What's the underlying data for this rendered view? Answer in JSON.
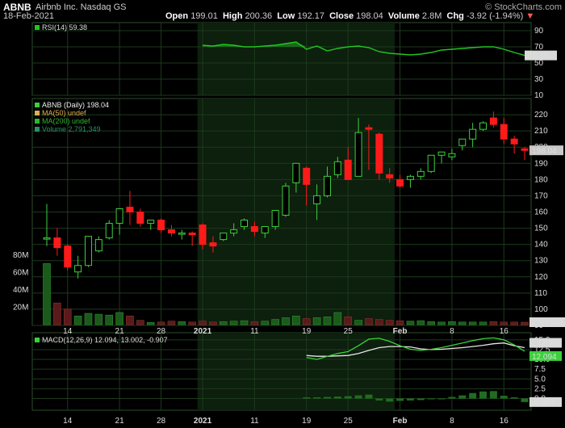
{
  "header": {
    "symbol": "ABNB",
    "company": "Airbnb Inc.  Nasdaq GS",
    "date": "18-Feb-2021",
    "open_label": "Open",
    "open": "199.01",
    "high_label": "High",
    "high": "200.36",
    "low_label": "Low",
    "low": "192.17",
    "close_label": "Close",
    "close": "198.04",
    "volume_label": "Volume",
    "volume": "2.8M",
    "chg_label": "Chg",
    "chg": "-3.92 (-1.94%)",
    "chg_icon": "down-triangle-icon",
    "brand": "© StockCharts.com"
  },
  "colors": {
    "up": "#3bd13b",
    "down": "#ff1a1a",
    "grid": "#1d3a1d",
    "rsi": "#22c422",
    "macd": "#3bd13b",
    "signal": "#e6e6e6",
    "price_badge": "#c8c8c8"
  },
  "chart_data": [
    {
      "type": "line",
      "name": "rsi-panel",
      "legend": "RSI(14) 59.38",
      "ylim": [
        10,
        100
      ],
      "yticks": [
        90,
        70,
        50,
        30,
        10
      ],
      "last_label": "59.38",
      "x": [
        "2021-01-04",
        "2021-01-05",
        "2021-01-06",
        "2021-01-07",
        "2021-01-08",
        "2021-01-11",
        "2021-01-12",
        "2021-01-13",
        "2021-01-14",
        "2021-01-15",
        "2021-01-19",
        "2021-01-20",
        "2021-01-21",
        "2021-01-22",
        "2021-01-25",
        "2021-01-26",
        "2021-01-27",
        "2021-01-28",
        "2021-01-29",
        "2021-02-01",
        "2021-02-02",
        "2021-02-03",
        "2021-02-04",
        "2021-02-05",
        "2021-02-08",
        "2021-02-09",
        "2021-02-10",
        "2021-02-11",
        "2021-02-12",
        "2021-02-16",
        "2021-02-17",
        "2021-02-18"
      ],
      "values": [
        72,
        71,
        73,
        72,
        70,
        70,
        71,
        72,
        74,
        76,
        67,
        71,
        65,
        68,
        70,
        71,
        69,
        64,
        62,
        61,
        60,
        61,
        63,
        66,
        67,
        68,
        69,
        70,
        70,
        67,
        63,
        59.38
      ]
    },
    {
      "type": "candlestick",
      "name": "price-panel",
      "legend": [
        "ABNB (Daily) 198.04",
        "MA(50) undef",
        "MA(200) undef",
        "Volume 2,791,349"
      ],
      "ylim": [
        90,
        230
      ],
      "yticks": [
        220,
        210,
        200,
        190,
        180,
        170,
        160,
        150,
        140,
        130,
        120,
        110,
        100,
        90
      ],
      "last_label": "198.04",
      "x_ticks": [
        "14",
        "21",
        "28",
        "2021",
        "11",
        "19",
        "25",
        "Feb",
        "8",
        "16"
      ],
      "x": [
        "2020-12-10",
        "2020-12-11",
        "2020-12-14",
        "2020-12-15",
        "2020-12-16",
        "2020-12-17",
        "2020-12-18",
        "2020-12-21",
        "2020-12-22",
        "2020-12-23",
        "2020-12-24",
        "2020-12-28",
        "2020-12-29",
        "2020-12-30",
        "2020-12-31",
        "2021-01-04",
        "2021-01-05",
        "2021-01-06",
        "2021-01-07",
        "2021-01-08",
        "2021-01-11",
        "2021-01-12",
        "2021-01-13",
        "2021-01-14",
        "2021-01-15",
        "2021-01-19",
        "2021-01-20",
        "2021-01-21",
        "2021-01-22",
        "2021-01-25",
        "2021-01-26",
        "2021-01-27",
        "2021-01-28",
        "2021-01-29",
        "2021-02-01",
        "2021-02-02",
        "2021-02-03",
        "2021-02-04",
        "2021-02-05",
        "2021-02-08",
        "2021-02-09",
        "2021-02-10",
        "2021-02-11",
        "2021-02-12",
        "2021-02-16",
        "2021-02-17",
        "2021-02-18"
      ],
      "open": [
        144,
        144,
        139,
        123,
        127,
        136,
        144,
        153,
        163,
        160,
        153,
        155,
        149,
        147,
        147,
        152,
        141,
        143,
        147,
        151,
        151,
        147,
        151,
        158,
        178,
        187,
        165,
        170,
        183,
        192,
        182,
        212,
        208,
        183,
        180,
        180,
        182,
        185,
        195,
        194,
        201,
        205,
        211,
        218,
        214,
        205,
        199
      ],
      "high": [
        165,
        150,
        140,
        133,
        145,
        145,
        155,
        161,
        173,
        162,
        154,
        156,
        152,
        149,
        148,
        153,
        145,
        147,
        153,
        156,
        154,
        151,
        161,
        178,
        190,
        188,
        177,
        188,
        194,
        200,
        218,
        214,
        209,
        187,
        183,
        183,
        187,
        192,
        196,
        199,
        205,
        215,
        216,
        222,
        218,
        207,
        200
      ],
      "low": [
        139,
        133,
        124,
        119,
        126,
        135,
        143,
        146,
        152,
        151,
        149,
        147,
        145,
        143,
        139,
        137,
        135,
        142,
        145,
        149,
        145,
        144,
        149,
        157,
        172,
        164,
        155,
        169,
        181,
        180,
        182,
        186,
        180,
        178,
        175,
        175,
        180,
        184,
        190,
        192,
        198,
        200,
        210,
        212,
        202,
        196,
        192
      ],
      "close": [
        144,
        138,
        126,
        127,
        145,
        143,
        153,
        162,
        160,
        153,
        155,
        149,
        147,
        147,
        146,
        140,
        139,
        147,
        149,
        155,
        148,
        151,
        161,
        176,
        190,
        177,
        170,
        182,
        191,
        180,
        209,
        211,
        184,
        181,
        176,
        182,
        185,
        195,
        197,
        196,
        205,
        211,
        215,
        214,
        205,
        202,
        198
      ],
      "volume": [
        70.4,
        25,
        18,
        10,
        13,
        12,
        11,
        14,
        10,
        5,
        2.5,
        3,
        4,
        3.5,
        3,
        4,
        3,
        3.5,
        4,
        4.5,
        3.5,
        4,
        6,
        8,
        10,
        7,
        8,
        9,
        14,
        9,
        5,
        7,
        6,
        5,
        4.5,
        4,
        4.5,
        3.5,
        3,
        3.5,
        3,
        3,
        3,
        3.5,
        3,
        3,
        2.79
      ],
      "vol_ylim": [
        0,
        95
      ],
      "vol_ticks": [
        "80M",
        "60M",
        "40M",
        "20M"
      ],
      "vol_last_label": "2791349"
    },
    {
      "type": "line",
      "name": "macd-panel",
      "legend": "MACD(12,26,9) 12.094, 13.002, -0.907",
      "ylim": [
        -3,
        16
      ],
      "yticks": [
        15.0,
        12.5,
        10.0,
        7.5,
        5.0,
        2.5,
        0.0
      ],
      "last_labels": [
        "13.002",
        "12.094",
        "-0.907"
      ],
      "x": [
        "2021-01-19",
        "2021-01-20",
        "2021-01-21",
        "2021-01-22",
        "2021-01-25",
        "2021-01-26",
        "2021-01-27",
        "2021-01-28",
        "2021-01-29",
        "2021-02-01",
        "2021-02-02",
        "2021-02-03",
        "2021-02-04",
        "2021-02-05",
        "2021-02-08",
        "2021-02-09",
        "2021-02-10",
        "2021-02-11",
        "2021-02-12",
        "2021-02-16",
        "2021-02-17",
        "2021-02-18"
      ],
      "series": [
        {
          "name": "MACD",
          "values": [
            10.5,
            10.0,
            10.8,
            11.5,
            12.0,
            13.5,
            15.2,
            15.4,
            14.6,
            13.5,
            12.6,
            12.3,
            12.6,
            13.0,
            13.6,
            14.2,
            14.8,
            15.3,
            15.5,
            15.0,
            13.7,
            12.094
          ]
        },
        {
          "name": "Signal",
          "values": [
            11.0,
            10.8,
            10.8,
            10.9,
            11.0,
            11.5,
            12.3,
            13.0,
            13.3,
            13.3,
            13.2,
            12.7,
            12.5,
            12.6,
            12.8,
            13.0,
            13.3,
            13.6,
            14.0,
            14.2,
            13.5,
            13.002
          ]
        },
        {
          "name": "Histogram",
          "values": [
            0.3,
            0.3,
            0.4,
            0.5,
            0.6,
            0.8,
            1.0,
            -0.5,
            -0.8,
            -0.6,
            -0.5,
            -0.4,
            -0.2,
            -0.1,
            0.4,
            0.8,
            1.4,
            1.8,
            1.9,
            0.7,
            0.3,
            -0.907
          ]
        }
      ]
    }
  ]
}
